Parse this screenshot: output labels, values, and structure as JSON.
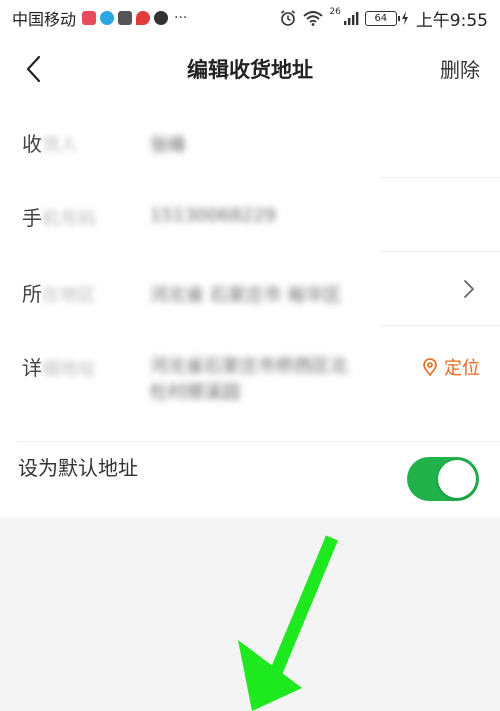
{
  "status_bar": {
    "carrier": "中国移动",
    "more": "···",
    "network": "26",
    "battery": "64",
    "time": "上午9:55"
  },
  "nav": {
    "title": "编辑收货地址",
    "delete_label": "删除"
  },
  "form": {
    "recipient": {
      "label_lead": "收",
      "label_rest": "货人",
      "value": "张峰"
    },
    "phone": {
      "label_lead": "手",
      "label_rest": "机号码",
      "value": "15130068229"
    },
    "region": {
      "label_lead": "所",
      "label_rest": "在地区",
      "value": "河北省 石家庄市 裕华区"
    },
    "address": {
      "label_lead": "详",
      "label_rest": "细地址",
      "value_line1": "河北省石家庄市桥西区北",
      "value_line2": "杜村顺溪园",
      "locate_label": "定位"
    },
    "default_address": {
      "label": "设为默认地址",
      "enabled": true
    }
  },
  "colors": {
    "accent_orange": "#e86a1c",
    "toggle_green": "#22b24c",
    "arrow_green": "#1ee81e"
  }
}
